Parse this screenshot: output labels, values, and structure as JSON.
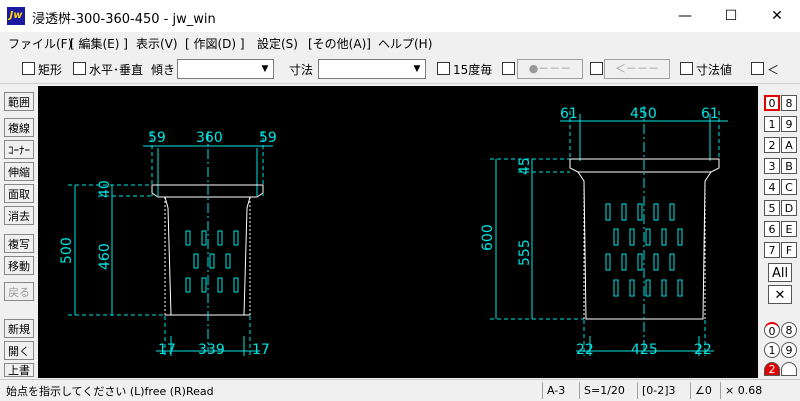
{
  "window": {
    "icon_text": "Jw",
    "title": "浸透桝-300-360-450 - jw_win",
    "minimize": "—",
    "maximize": "☐",
    "close": "✕"
  },
  "menu": [
    "ファイル(F)",
    "[ 編集(E) ]",
    "表示(V)",
    "[ 作図(D) ]",
    "設定(S)",
    "[その他(A)]",
    "ヘルプ(H)"
  ],
  "toolbar": {
    "rect_label": "矩形",
    "hv_label": "水平･垂直",
    "slope_label": "傾き",
    "slope_value": "",
    "dim_label": "寸法",
    "dim_value": "",
    "deg15_label": "15度毎",
    "arrow1": "●－－－",
    "arrow2": "＜－－－",
    "dimval_label": "寸法値",
    "lt_label": "＜"
  },
  "left_tools": [
    "範囲",
    "複線",
    "ｺｰﾅｰ",
    "伸縮",
    "面取",
    "消去",
    "複写",
    "移動",
    "戻る",
    "新規",
    "開く",
    "上書"
  ],
  "right_tools": {
    "layers_left": [
      "0",
      "1",
      "2",
      "3",
      "4",
      "5",
      "6",
      "7"
    ],
    "layers_right": [
      "8",
      "9",
      "A",
      "B",
      "C",
      "D",
      "E",
      "F"
    ],
    "all": "All",
    "cross": "✕",
    "groups_left": [
      "0",
      "1",
      "2"
    ],
    "groups_right": [
      "8",
      "9",
      ""
    ]
  },
  "drawing": {
    "left": {
      "top_dims": [
        "59",
        "360",
        "59"
      ],
      "bottom_dims": [
        "17",
        "339",
        "17"
      ],
      "left_dims": [
        "40",
        "460",
        "500"
      ]
    },
    "right": {
      "top_dims": [
        "61",
        "450",
        "61"
      ],
      "bottom_dims": [
        "22",
        "425",
        "22"
      ],
      "left_dims": [
        "45",
        "555",
        "600"
      ]
    }
  },
  "status": {
    "message": "始点を指示してください (L)free (R)Read",
    "paper": "A-3",
    "scale": "S=1/20",
    "layer": "[0-2]3",
    "angle": "∠0",
    "zoom": "× 0.68"
  },
  "colors": {
    "canvas": "#000000",
    "line": "#ffffff",
    "dimension": "#00e5e5",
    "active_layer": "#e00000"
  }
}
